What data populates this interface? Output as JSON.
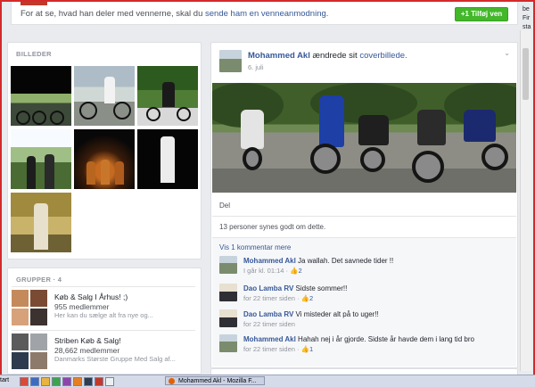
{
  "top_banner": {
    "message_prefix": "For at se, hvad han deler med vennerne, skal du ",
    "message_link": "sende ham en venneanmodning.",
    "add_friend_label": "+1 Tilføj ven",
    "right_cut_text": "be\nFir\nsta"
  },
  "photos": {
    "title": "BILLEDER",
    "count": 7
  },
  "groups": {
    "title": "GRUPPER · 4",
    "items": [
      {
        "name": "Køb & Salg I Århus! ;)",
        "members": "955 medlemmer",
        "desc": "Her kan du sælge alt fra nye og..."
      },
      {
        "name": "Striben Køb & Salg!",
        "members": "28,662 medlemmer",
        "desc": "Danmarks Største Gruppe Med Salg af..."
      }
    ]
  },
  "post": {
    "author": "Mohammed Akl",
    "action": " ændrede sit ",
    "action_link": "coverbillede.",
    "date": "6. juli",
    "share_label": "Del",
    "likes_text": "13 personer synes godt om dette.",
    "more_comments": "Vis 1 kommentar mere",
    "comments": [
      {
        "author": "Mohammed Akl",
        "text": " Ja wallah. Det savnede tider !!",
        "time": "I går kl. 01:14 · ",
        "likes": "2"
      },
      {
        "author": "Dao Lamba RV",
        "text": " Sidste sommer!!",
        "time": "for 22 timer siden · ",
        "likes": "2"
      },
      {
        "author": "Dao Lamba RV",
        "text": " Vi misteder alt på to uger!!",
        "time": "for 22 timer siden",
        "likes": ""
      },
      {
        "author": "Mohammed Akl",
        "text": " Hahah nej i år gjorde. Sidste år havde dem i lang tid bro",
        "time": "for 22 timer siden · ",
        "likes": "1"
      }
    ]
  },
  "taskbar": {
    "start_label": "tart",
    "window_title": "Mohammed Akl - Mozilla F..."
  },
  "colors": {
    "link": "#365899",
    "green_button": "#42b72a",
    "frame_red": "#d42a2a"
  }
}
